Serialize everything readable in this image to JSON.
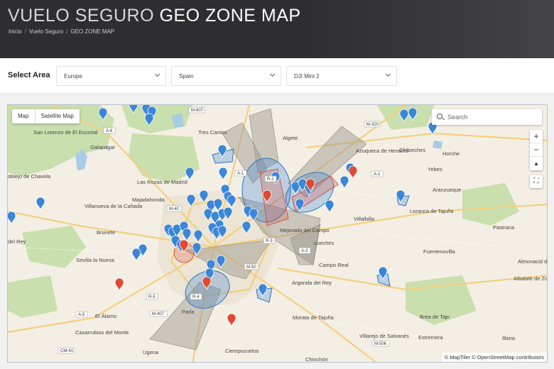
{
  "header": {
    "brand": "VUELO SEGURO",
    "title": "GEO ZONE MAP",
    "breadcrumb": [
      "Inicio",
      "Vuelo Seguro",
      "GEO ZONE MAP"
    ]
  },
  "filters": {
    "label": "Select Area",
    "region": "Europe",
    "country": "Spain",
    "drone": "DJI Mini 2"
  },
  "map": {
    "view_toggle": [
      "Map",
      "Satellite Map"
    ],
    "search_placeholder": "Search",
    "zoom_in": "+",
    "zoom_out": "−",
    "compass": "▲",
    "fullscreen": "⛶",
    "attribution": "© MapTiler © OpenStreetMap contributors",
    "colors": {
      "restricted": "#e04a35",
      "controlled": "#3b86d8",
      "corridor": "#9a958c",
      "land": "#f4efe4",
      "forest": "#c9dfae",
      "water": "#a9cbe4",
      "road": "#f3cf7f"
    },
    "place_labels": [
      "San Lorenzo de El Escorial",
      "Galapagar",
      "Tres Cantos",
      "Algete",
      "Azuqueca de Henares",
      "Chiloeches",
      "Horche",
      "Yebes",
      "Aranzueque",
      "Villalbilla",
      "Loranca de Tajuña",
      "Pastrana",
      "Las Rozas de Madrid",
      "Majadahonda",
      "Villanueva de la Cañada",
      "Brunete",
      "Sevilla la Nueva",
      "Mejorada del Campo",
      "Loeches",
      "Campo Real",
      "Arganda del Rey",
      "Fuentenovilla",
      "Almonacid de Zorita",
      "Albalate de Zo",
      "Parla",
      "El Álamo",
      "Casarrubios del Monte",
      "Ugena",
      "Ciempozuelos",
      "Morata de Tajuña",
      "Villarejo de Salvanés",
      "Brea de Tajo",
      "Estremera",
      "Illana",
      "Chinchón",
      "oblejo de Chavela",
      "del Rey"
    ],
    "road_labels": [
      "M-607",
      "A-6",
      "A-1",
      "M-40",
      "R-2",
      "A-2",
      "M-320",
      "R-3",
      "A-3",
      "M-50",
      "R-5",
      "A-5",
      "M-407",
      "R-4",
      "CM-41",
      "M-506"
    ]
  }
}
